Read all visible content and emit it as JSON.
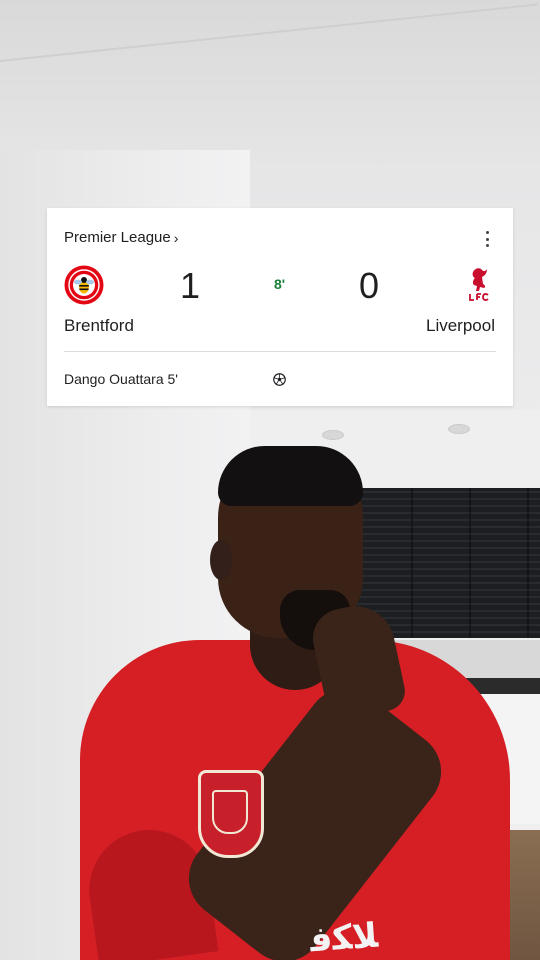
{
  "scorecard": {
    "league_label": "Premier League",
    "league_chevron": "›",
    "menu_icon": "more-vert-icon",
    "match_minute": "8'",
    "home": {
      "name": "Brentford",
      "score": "1",
      "crest_text": "BRENTFORD"
    },
    "away": {
      "name": "Liverpool",
      "score": "0",
      "crest_text": "LFC"
    },
    "events": [
      {
        "text": "Dango Ouattara 5'",
        "icon": "soccer-ball-icon"
      }
    ],
    "colors": {
      "minute_green": "#188038",
      "brentford_red": "#e30613",
      "liverpool_red": "#c8102e"
    }
  },
  "background": {
    "shirt_color": "#d51f25"
  }
}
